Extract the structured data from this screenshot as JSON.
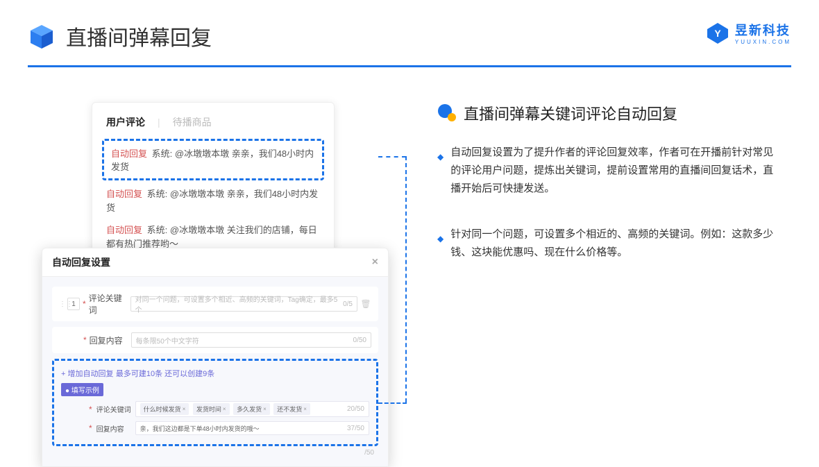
{
  "header": {
    "title": "直播间弹幕回复",
    "brand_name": "昱新科技",
    "brand_sub": "YUUXIN.COM"
  },
  "comments": {
    "tab_active": "用户评论",
    "tab_inactive": "待播商品",
    "row1_tag": "自动回复",
    "row1_sys": "系统:",
    "row1_text": "@冰墩墩本墩 亲亲，我们48小时内发货",
    "row2_tag": "自动回复",
    "row2_sys": "系统:",
    "row2_text": "@冰墩墩本墩 亲亲，我们48小时内发货",
    "row3_tag": "自动回复",
    "row3_sys": "系统:",
    "row3_text": "@冰墩墩本墩 关注我们的店铺，每日都有热门推荐哟～"
  },
  "settings": {
    "title": "自动回复设置",
    "idx": "1",
    "kw_label": "评论关键词",
    "kw_ph": "对同一个问题，可设置多个相近、高频的关键词，Tag确定，最多5个",
    "kw_counter": "0/5",
    "content_label": "回复内容",
    "content_ph": "每条限50个中文字符",
    "content_counter": "0/50",
    "add_link": "+ 增加自动回复",
    "add_hint": "最多可建10条 还可以创建9条",
    "example_badge": "● 填写示例",
    "ex_kw_label": "评论关键词",
    "ex_tags": [
      "什么时候发货",
      "发货时间",
      "多久发货",
      "还不发货"
    ],
    "ex_kw_counter": "20/50",
    "ex_content_label": "回复内容",
    "ex_content_val": "亲，我们这边都是下单48小时内发货的哦～",
    "ex_content_counter": "37/50",
    "outer_counter": "/50"
  },
  "right": {
    "section_title": "直播间弹幕关键词评论自动回复",
    "bullet1": "自动回复设置为了提升作者的评论回复效率，作者可在开播前针对常见的评论用户问题，提炼出关键词，提前设置常用的直播间回复话术，直播开始后可快捷发送。",
    "bullet2": "针对同一个问题，可设置多个相近的、高频的关键词。例如：这款多少钱、这块能优惠吗、现在什么价格等。"
  }
}
